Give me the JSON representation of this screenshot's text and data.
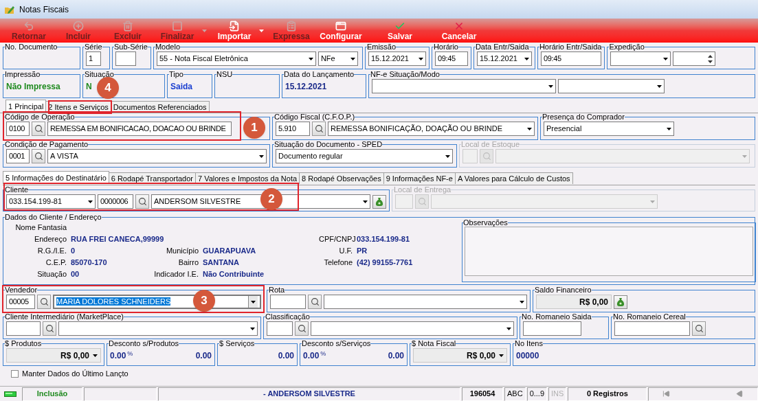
{
  "window": {
    "title": "Notas Fiscais"
  },
  "toolbar": [
    {
      "label": "Retornar",
      "disabled": true,
      "menu": false
    },
    {
      "label": "Incluir",
      "disabled": true,
      "menu": false
    },
    {
      "label": "Excluir",
      "disabled": true,
      "menu": false
    },
    {
      "label": "Finalizar",
      "disabled": true,
      "menu": true
    },
    {
      "label": "Importar",
      "disabled": false,
      "menu": true
    },
    {
      "label": "Expressa",
      "disabled": true,
      "menu": false
    },
    {
      "label": "Configurar",
      "disabled": false,
      "menu": false
    },
    {
      "label": "Salvar",
      "disabled": false,
      "menu": false
    },
    {
      "label": "Cancelar",
      "disabled": false,
      "menu": false
    }
  ],
  "header_rows": [
    [
      {
        "label": "No. Documento",
        "disabled": false
      },
      {
        "label": "Série",
        "disabled": false,
        "controls": [
          {
            "kind": "text",
            "value": "1"
          }
        ]
      },
      {
        "label": "Sub-Série",
        "disabled": false,
        "controls": [
          {
            "kind": "text"
          }
        ]
      },
      {
        "label": "Modelo",
        "disabled": false,
        "controls": [
          {
            "kind": "combo",
            "value": "55 - Nota Fiscal Eletrônica"
          },
          {
            "kind": "combo",
            "value": "NFe"
          }
        ]
      },
      {
        "label": "Emissão",
        "disabled": false,
        "controls": [
          {
            "kind": "combo",
            "value": "15.12.2021"
          }
        ]
      },
      {
        "label": "Horário",
        "disabled": false,
        "controls": [
          {
            "kind": "text",
            "value": "09:45"
          }
        ]
      },
      {
        "label": "Data Entr/Saida",
        "disabled": false,
        "controls": [
          {
            "kind": "combo",
            "value": "15.12.2021"
          }
        ]
      },
      {
        "label": "Horário Entr/Saida",
        "disabled": false,
        "controls": [
          {
            "kind": "text",
            "value": "09:45"
          }
        ]
      },
      {
        "label": "Expedição",
        "disabled": false,
        "controls": [
          {
            "kind": "combo"
          },
          {
            "kind": "spin"
          }
        ]
      }
    ],
    [
      {
        "label": "Impressão",
        "disabled": false,
        "controls": [
          {
            "kind": "status",
            "value": "Não Impressa"
          }
        ]
      },
      {
        "label": "Situação",
        "disabled": false,
        "controls": [
          {
            "kind": "status",
            "value": "N"
          }
        ]
      },
      {
        "label": "Tipo",
        "disabled": false,
        "controls": [
          {
            "kind": "info",
            "value": "Saida"
          }
        ]
      },
      {
        "label": "NSU",
        "disabled": false
      },
      {
        "label": "Data do Lançamento",
        "disabled": false,
        "controls": [
          {
            "kind": "date",
            "value": "15.12.2021"
          }
        ]
      },
      {
        "label": "NF-e Situação/Modo",
        "disabled": false,
        "controls": [
          {
            "kind": "combo"
          },
          {
            "kind": "combo"
          }
        ]
      }
    ]
  ],
  "tabs": [
    {
      "label": "1 Principal",
      "selected": true
    },
    {
      "label": "2 Itens e Serviços",
      "selected": false
    },
    {
      "label": "Documentos Referenciados",
      "selected": false
    }
  ],
  "principal_rows": [
    [
      {
        "label": "Código de Operação",
        "disabled": false,
        "controls": [
          {
            "kind": "text",
            "value": "0100"
          },
          {
            "kind": "lookup"
          },
          {
            "kind": "text",
            "value": "REMESSA EM BONIFICACAO, DOACAO OU BRINDE"
          }
        ]
      },
      {
        "label": "Código Fiscal (C.F.O.P.)",
        "disabled": false,
        "controls": [
          {
            "kind": "text",
            "value": "5.910"
          },
          {
            "kind": "lookup"
          },
          {
            "kind": "combo",
            "value": "REMESSA BONIFICAÇÃO, DOAÇÃO OU BRINDE"
          }
        ]
      },
      {
        "label": "Presença do Comprador",
        "disabled": false,
        "controls": [
          {
            "kind": "combo",
            "value": "Presencial"
          }
        ]
      }
    ],
    [
      {
        "label": "Condição de Pagamento",
        "disabled": false,
        "controls": [
          {
            "kind": "text",
            "value": "0001"
          },
          {
            "kind": "lookup"
          },
          {
            "kind": "combo",
            "value": "A VISTA"
          }
        ]
      },
      {
        "label": "Situação do Documento - SPED",
        "disabled": false,
        "controls": [
          {
            "kind": "combo",
            "value": "Documento regular"
          }
        ]
      },
      {
        "label": "Local de Estoque",
        "disabled": true,
        "controls": [
          {
            "kind": "text"
          },
          {
            "kind": "lookup"
          },
          {
            "kind": "combo"
          }
        ]
      }
    ]
  ],
  "sub_tabs": [
    {
      "label": "5 Informações do Destinatário",
      "selected": true
    },
    {
      "label": "6 Rodapé Transportador",
      "selected": false
    },
    {
      "label": "7 Valores e Impostos da Nota",
      "selected": false
    },
    {
      "label": "8 Rodapé Observações",
      "selected": false
    },
    {
      "label": "9 Informações NF-e",
      "selected": false
    },
    {
      "label": "A Valores para Cálculo de Custos",
      "selected": false
    }
  ],
  "client_row": [
    {
      "label": "Cliente",
      "disabled": false,
      "controls": [
        {
          "kind": "combo",
          "value": "033.154.199-81"
        },
        {
          "kind": "text",
          "value": "0000006"
        },
        {
          "kind": "lookup"
        },
        {
          "kind": "combo",
          "value": "ANDERSOM SILVESTRE"
        },
        {
          "kind": "bag"
        }
      ]
    },
    {
      "label": "Local de Entrega",
      "disabled": true,
      "controls": [
        {
          "kind": "text"
        },
        {
          "kind": "lookup"
        },
        {
          "kind": "combo"
        }
      ]
    }
  ],
  "client_details": {
    "label": "Dados do Cliente / Endereço",
    "rows": [
      {
        "left": {
          "label": "Nome Fantasia"
        }
      },
      {
        "left": {
          "label": "Endereço",
          "value": "RUA FREI CANECA,99999"
        },
        "right": {
          "label": "CPF/CNPJ",
          "value": "033.154.199-81"
        }
      },
      {
        "left": {
          "label": "R.G./I.E.",
          "value": "0"
        },
        "middle": {
          "label": "Município",
          "value": "GUARAPUAVA"
        },
        "right": {
          "label": "U.F.",
          "value": "PR"
        }
      },
      {
        "left": {
          "label": "C.E.P.",
          "value": "85070-170"
        },
        "middle": {
          "label": "Bairro",
          "value": "SANTANA"
        },
        "right": {
          "label": "Telefone",
          "value": "(42) 99155-7761"
        }
      },
      {
        "left": {
          "label": "Situação",
          "value": "00"
        },
        "middle": {
          "label": "Indicador I.E.",
          "value": "Não Contribuinte"
        }
      }
    ],
    "notes": {
      "label": "Observações"
    }
  },
  "lower_rows": [
    [
      {
        "label": "Vendedor",
        "disabled": false,
        "controls": [
          {
            "kind": "text",
            "value": "00005"
          },
          {
            "kind": "lookup"
          },
          {
            "kind": "combo",
            "value": "MARIA DOLORES SCHNEIDERS",
            "selected": true
          }
        ]
      },
      {
        "label": "Rota",
        "disabled": false,
        "controls": [
          {
            "kind": "text"
          },
          {
            "kind": "lookup"
          },
          {
            "kind": "combo",
            "selected": false
          }
        ]
      },
      {
        "label": "Saldo Financeiro",
        "disabled": false,
        "controls": [
          {
            "kind": "money",
            "value": "R$ 0,00"
          },
          {
            "kind": "bag"
          }
        ]
      }
    ],
    [
      {
        "label": "Cliente Intermediário (MarketPlace)",
        "disabled": false,
        "controls": [
          {
            "kind": "text"
          },
          {
            "kind": "lookup"
          },
          {
            "kind": "combo"
          }
        ]
      },
      {
        "label": "Classificação",
        "disabled": false,
        "controls": [
          {
            "kind": "text"
          },
          {
            "kind": "lookup"
          },
          {
            "kind": "combo"
          }
        ]
      },
      {
        "label": "No. Romaneio Saida",
        "disabled": false,
        "controls": [
          {
            "kind": "text"
          }
        ]
      },
      {
        "label": "No. Romaneio Cereal",
        "disabled": false,
        "controls": [
          {
            "kind": "text"
          },
          {
            "kind": "lookup"
          }
        ]
      }
    ],
    [
      {
        "label": "$ Produtos",
        "disabled": false,
        "controls": [
          {
            "kind": "money-menu",
            "value": "R$ 0,00"
          }
        ]
      },
      {
        "label": "Desconto s/Produtos",
        "disabled": false,
        "controls": [
          {
            "kind": "percent",
            "value": "0.00",
            "unit": "%"
          },
          {
            "kind": "number",
            "value": "0.00"
          }
        ]
      },
      {
        "label": "$ Serviços",
        "disabled": false,
        "controls": [
          {
            "kind": "number",
            "value": "0.00"
          }
        ]
      },
      {
        "label": "Desconto s/Serviços",
        "disabled": false,
        "controls": [
          {
            "kind": "percent",
            "value": "0.00",
            "unit": "%"
          },
          {
            "kind": "number",
            "value": "0.00"
          }
        ]
      },
      {
        "label": "$ Nota Fiscal",
        "disabled": false,
        "controls": [
          {
            "kind": "money-menu",
            "value": "R$ 0,00"
          }
        ]
      },
      {
        "label": "No Itens",
        "disabled": false,
        "controls": [
          {
            "kind": "date",
            "value": "00000"
          }
        ]
      }
    ]
  ],
  "keep_data": {
    "label": "Manter Dados do Último Lançto",
    "checked": false
  },
  "status_bar": [
    {
      "kind": "led"
    },
    {
      "kind": "mode",
      "text": "Inclusão"
    },
    {
      "kind": "blank"
    },
    {
      "kind": "title",
      "text": "- ANDERSOM SILVESTRE"
    },
    {
      "kind": "code",
      "text": "196054"
    },
    {
      "kind": "flag",
      "text": "ABC",
      "disabled": false
    },
    {
      "kind": "flag",
      "text": "0...9",
      "disabled": false
    },
    {
      "kind": "flag",
      "text": "INS",
      "disabled": true
    },
    {
      "kind": "count",
      "text": "0 Registros"
    },
    {
      "kind": "nav"
    }
  ],
  "callouts": [
    {
      "label": "1"
    },
    {
      "label": "2"
    },
    {
      "label": "3"
    },
    {
      "label": "4"
    }
  ]
}
